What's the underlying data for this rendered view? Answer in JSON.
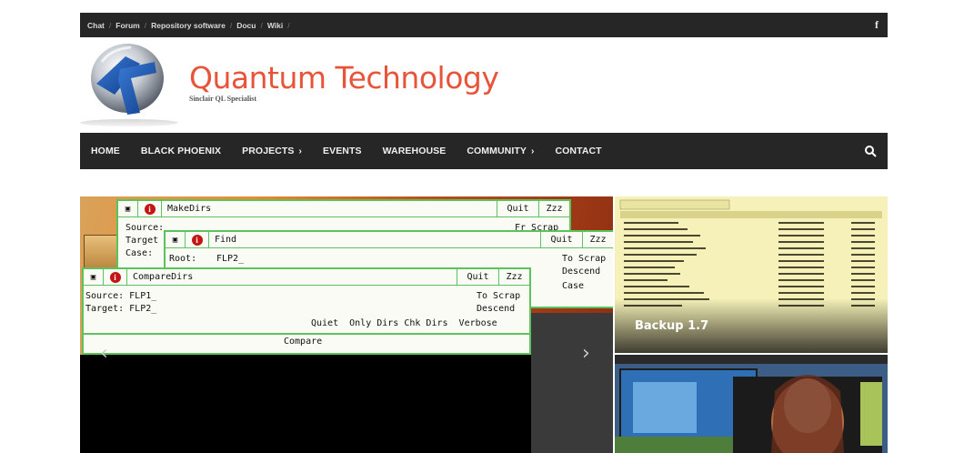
{
  "topbar": {
    "links": [
      "Chat",
      "Forum",
      "Repository software",
      "Docu",
      "Wiki"
    ],
    "separator": "/",
    "social_icon": "f"
  },
  "header": {
    "title": "Quantum Technology",
    "tagline": "Sinclair QL Specialist"
  },
  "nav": {
    "items": [
      {
        "label": "HOME",
        "chevron": ""
      },
      {
        "label": "BLACK PHOENIX",
        "chevron": ""
      },
      {
        "label": "PROJECTS",
        "chevron": "›"
      },
      {
        "label": "EVENTS",
        "chevron": ""
      },
      {
        "label": "WAREHOUSE",
        "chevron": ""
      },
      {
        "label": "COMMUNITY",
        "chevron": "›"
      },
      {
        "label": "CONTACT",
        "chevron": ""
      }
    ]
  },
  "slider": {
    "window1": {
      "title": "MakeDirs",
      "quit": "Quit",
      "zz": "Zzz",
      "lines": [
        "Source:",
        "Target",
        "Case:"
      ],
      "right": "Fr Scrap"
    },
    "window2": {
      "title": "Find",
      "quit": "Quit",
      "zz": "Zzz",
      "root_label": "Root:",
      "root_value": "FLP2_",
      "right1": "To Scrap",
      "right2": "Descend",
      "right3": "Case"
    },
    "window3": {
      "title": "CompareDirs",
      "quit": "Quit",
      "zz": "Zzz",
      "source": "Source: FLP1_",
      "target": "Target: FLP2_",
      "to_scrap": "To Scrap",
      "descend": "Descend",
      "options": "Quiet  Only Dirs Chk Dirs  Verbose",
      "compare": "Compare"
    },
    "prev_arrow": "‹",
    "next_arrow": "›"
  },
  "thumbs": [
    {
      "caption": "Backup 1.7"
    },
    {
      "caption": ""
    }
  ],
  "colors": {
    "accent": "#e8543a",
    "dark": "#262626",
    "ql_green": "#5cc25c"
  }
}
